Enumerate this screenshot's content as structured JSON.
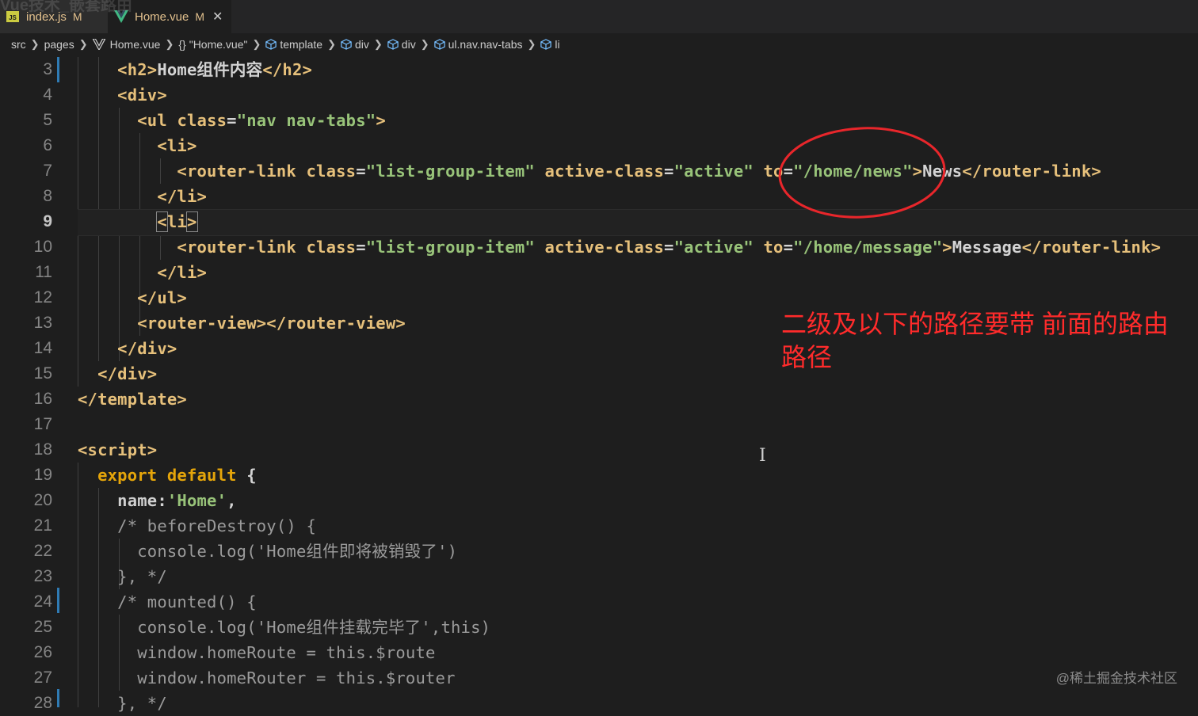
{
  "tabs": [
    {
      "label": "index.js",
      "status": "M",
      "icon": "js-file-icon",
      "active": false
    },
    {
      "label": "Home.vue",
      "status": "M",
      "icon": "vue-file-icon",
      "active": true
    }
  ],
  "ghost_title": "Vue技术_嵌套路由",
  "breadcrumb": {
    "src": "src",
    "pages": "pages",
    "file": "Home.vue",
    "component": "\"Home.vue\"",
    "template": "template",
    "div1": "div",
    "div2": "div",
    "ul": "ul.nav.nav-tabs",
    "li": "li"
  },
  "editor": {
    "current_line": 9,
    "line_numbers": [
      "3",
      "4",
      "5",
      "6",
      "7",
      "8",
      "9",
      "10",
      "11",
      "12",
      "13",
      "14",
      "15",
      "16",
      "17",
      "18",
      "19",
      "20",
      "21",
      "22",
      "23",
      "24",
      "25",
      "26",
      "27",
      "28"
    ]
  },
  "annotation": {
    "line1": "二级及以下的路径要带 前面的路由",
    "line2": "路径",
    "color": "#ff2b2b"
  },
  "watermark": "@稀土掘金技术社区",
  "colors": {
    "background": "#1e1e1e",
    "tag": "#e6c07b",
    "string": "#98c379",
    "keyword": "#e5a50a",
    "comment": "#9b9b9b"
  }
}
